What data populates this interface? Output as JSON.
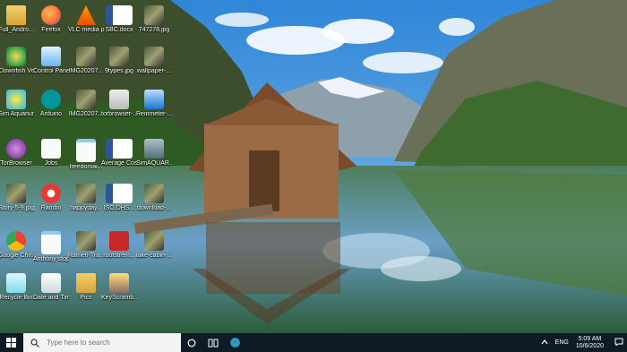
{
  "desktop_icons": [
    {
      "label": "Full_Andro...",
      "icon": "folder-icon"
    },
    {
      "label": "Firefox",
      "icon": "firefox-icon"
    },
    {
      "label": "VLC media player",
      "icon": "vlc-icon"
    },
    {
      "label": "SBC.docx",
      "icon": "word-doc-icon"
    },
    {
      "label": "747278.jpg",
      "icon": "image-file-icon"
    },
    {
      "label": "Clownfish Voice...",
      "icon": "clownfish-icon"
    },
    {
      "label": "Control Panel",
      "icon": "control-panel-icon"
    },
    {
      "label": "IMG20207...",
      "icon": "image-file-icon"
    },
    {
      "label": "9types.jpg",
      "icon": "image-file-icon"
    },
    {
      "label": "wallpaper-...",
      "icon": "image-file-icon"
    },
    {
      "label": "Sim Aquarium 3",
      "icon": "sim-aquarium-icon"
    },
    {
      "label": "Arduino",
      "icon": "arduino-icon"
    },
    {
      "label": "IMG20207...",
      "icon": "image-file-icon"
    },
    {
      "label": "torbrowser-...",
      "icon": "tor-installer-icon"
    },
    {
      "label": "Reinmeter-...",
      "icon": "rainmeter-icon"
    },
    {
      "label": "TorBrowser",
      "icon": "tor-browser-icon"
    },
    {
      "label": "Jobs",
      "icon": "text-file-icon"
    },
    {
      "label": "freedomai...",
      "icon": "document-icon"
    },
    {
      "label": "Average Cost Overview.d...",
      "icon": "word-doc-icon"
    },
    {
      "label": "SimAQUAR...",
      "icon": "shortcut-icon"
    },
    {
      "label": "Story-5-9.jpg",
      "icon": "image-file-icon"
    },
    {
      "label": "Rambo",
      "icon": "rambo-icon"
    },
    {
      "label": "happyday...",
      "icon": "image-file-icon"
    },
    {
      "label": "ISO.DHS...",
      "icon": "word-doc-icon"
    },
    {
      "label": "download-...",
      "icon": "image-file-icon"
    },
    {
      "label": "Google Chrome",
      "icon": "chrome-icon"
    },
    {
      "label": "Anthony stop drinki...",
      "icon": "document-icon"
    },
    {
      "label": "Ramen-Tra...",
      "icon": "image-file-icon"
    },
    {
      "label": "rootstrem...",
      "icon": "mcafee-icon"
    },
    {
      "label": "lake-cabin-...",
      "icon": "image-file-icon"
    },
    {
      "label": "Recycle Bin",
      "icon": "recycle-bin-icon"
    },
    {
      "label": "Date and Time",
      "icon": "date-time-icon"
    },
    {
      "label": "Pics",
      "icon": "folder-icon"
    },
    {
      "label": "KeyScramb...",
      "icon": "keyscrambler-icon"
    }
  ],
  "taskbar": {
    "search_placeholder": "Type here to search",
    "clock_time": "5:09 AM",
    "clock_date": "10/6/2020",
    "language": "ENG"
  },
  "colors": {
    "taskbar": "#0e1a24",
    "search_box": "#f3f3f3",
    "folder": "#e8b94a",
    "word_blue": "#2b5797"
  }
}
